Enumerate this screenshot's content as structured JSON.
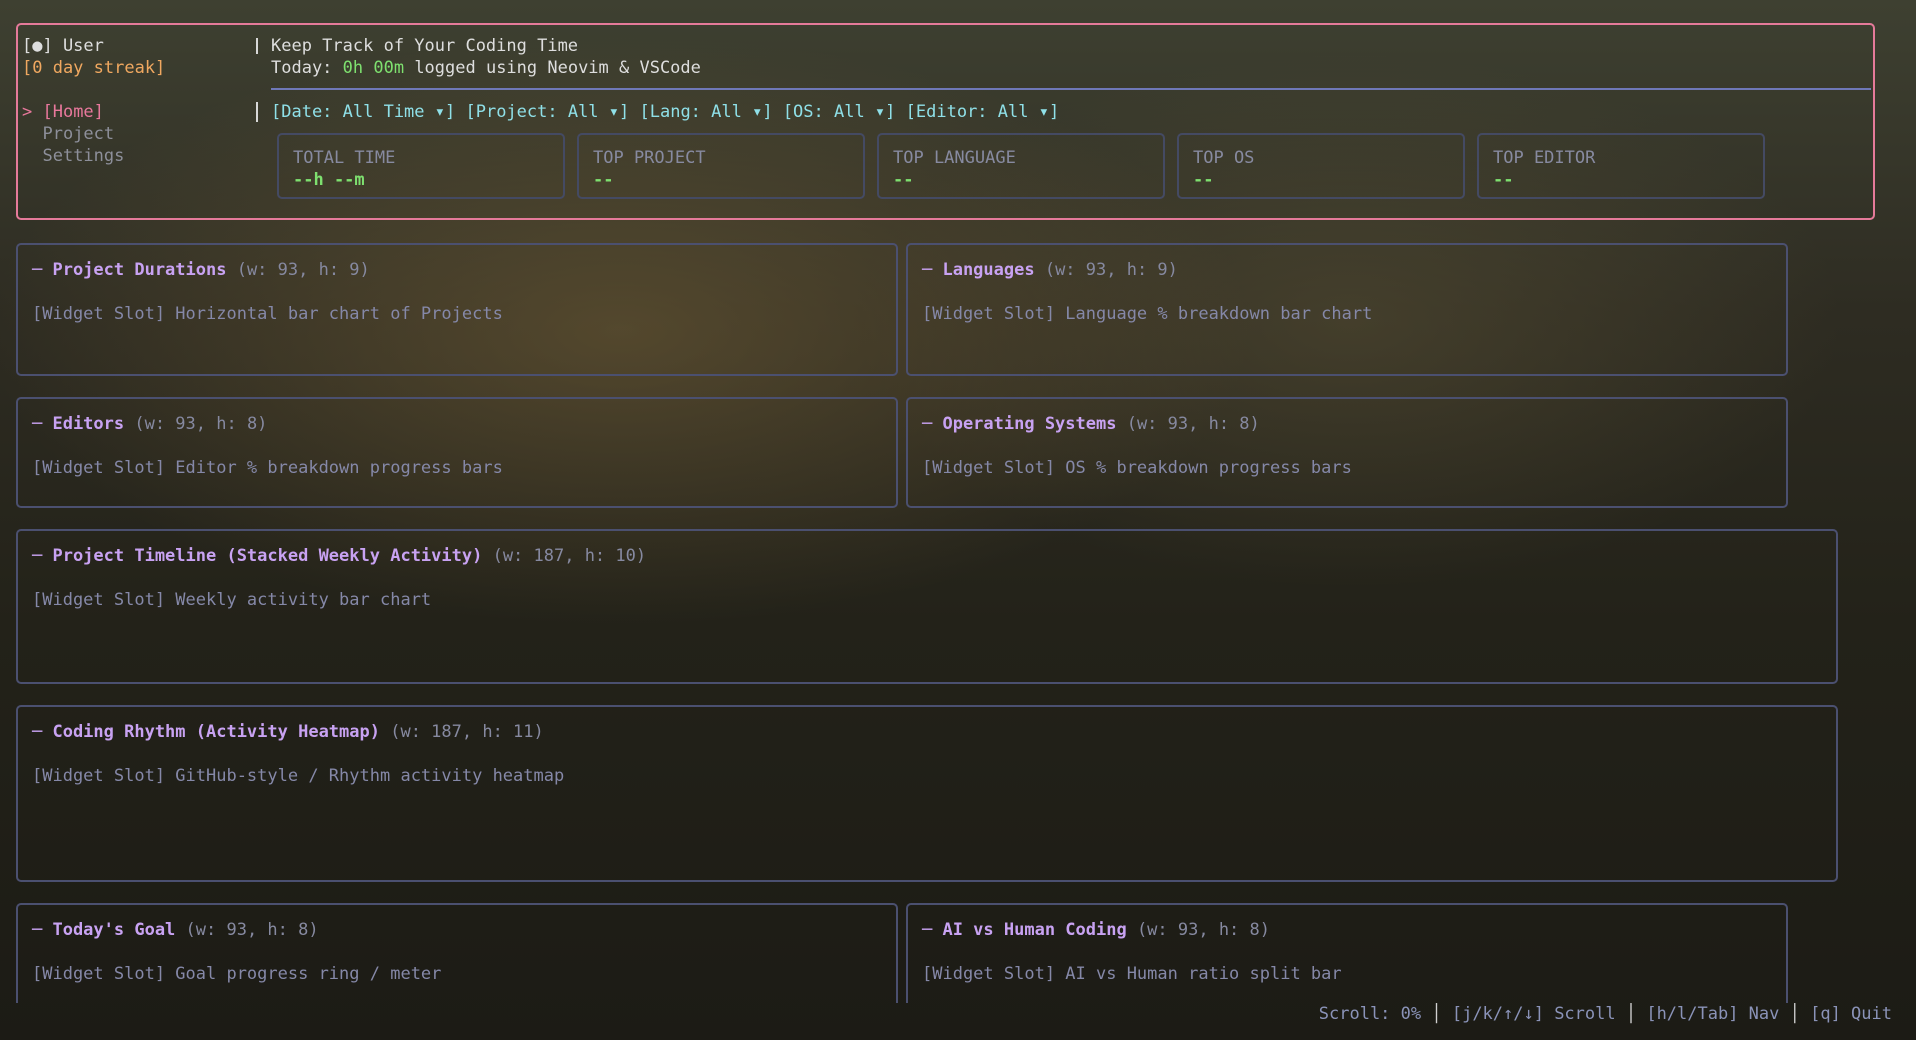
{
  "header": {
    "user_label": "[●] User",
    "streak": "[0 day streak]",
    "app_title": "Keep Track of Your Coding Time",
    "today_prefix": "Today: ",
    "today_time": "0h 00m",
    "today_suffix": " logged using Neovim & VSCode"
  },
  "nav": {
    "items": [
      {
        "label": "[Home]",
        "prefix": "> ",
        "active": true
      },
      {
        "label": "Project",
        "prefix": "  ",
        "active": false
      },
      {
        "label": "Settings",
        "prefix": "  ",
        "active": false
      }
    ]
  },
  "filters": [
    "[Date: All Time ▾]",
    "[Project: All ▾]",
    "[Lang: All ▾]",
    "[OS: All ▾]",
    "[Editor: All ▾]"
  ],
  "stats": [
    {
      "label": "TOTAL TIME",
      "value": "--h --m"
    },
    {
      "label": "TOP PROJECT",
      "value": "--"
    },
    {
      "label": "TOP LANGUAGE",
      "value": "--"
    },
    {
      "label": "TOP OS",
      "value": "--"
    },
    {
      "label": "TOP EDITOR",
      "value": "--"
    }
  ],
  "widgets": [
    {
      "title": "─ Project Durations",
      "dims": " (w: 93, h: 9)",
      "slot": "[Widget Slot] Horizontal bar chart of Projects"
    },
    {
      "title": "─ Languages",
      "dims": " (w: 93, h: 9)",
      "slot": "[Widget Slot] Language % breakdown bar chart"
    },
    {
      "title": "─ Editors",
      "dims": " (w: 93, h: 8)",
      "slot": "[Widget Slot] Editor % breakdown progress bars"
    },
    {
      "title": "─ Operating Systems",
      "dims": " (w: 93, h: 8)",
      "slot": "[Widget Slot] OS % breakdown progress bars"
    },
    {
      "title": "─ Project Timeline (Stacked Weekly Activity)",
      "dims": " (w: 187, h: 10)",
      "slot": "[Widget Slot] Weekly activity bar chart"
    },
    {
      "title": "─ Coding Rhythm (Activity Heatmap)",
      "dims": " (w: 187, h: 11)",
      "slot": "[Widget Slot] GitHub-style / Rhythm activity heatmap"
    },
    {
      "title": "─ Today's Goal",
      "dims": " (w: 93, h: 8)",
      "slot": "[Widget Slot] Goal progress ring / meter"
    },
    {
      "title": "─ AI vs Human Coding",
      "dims": " (w: 93, h: 8)",
      "slot": "[Widget Slot] AI vs Human ratio split bar"
    }
  ],
  "status": {
    "scroll": "Scroll: 0%",
    "sep": " │ ",
    "scroll_keys": "[j/k/↑/↓] Scroll",
    "nav_keys": "[h/l/Tab] Nav",
    "quit_keys": "[q] Quit"
  },
  "colors": {
    "header_border": "#e57a9a",
    "panel_border": "#4b5070",
    "accent_green": "#7ee06f",
    "accent_pink": "#e8789c",
    "accent_cyan": "#8fe0e8",
    "title_purple": "#c8a2f2",
    "streak_orange": "#f0a860"
  }
}
